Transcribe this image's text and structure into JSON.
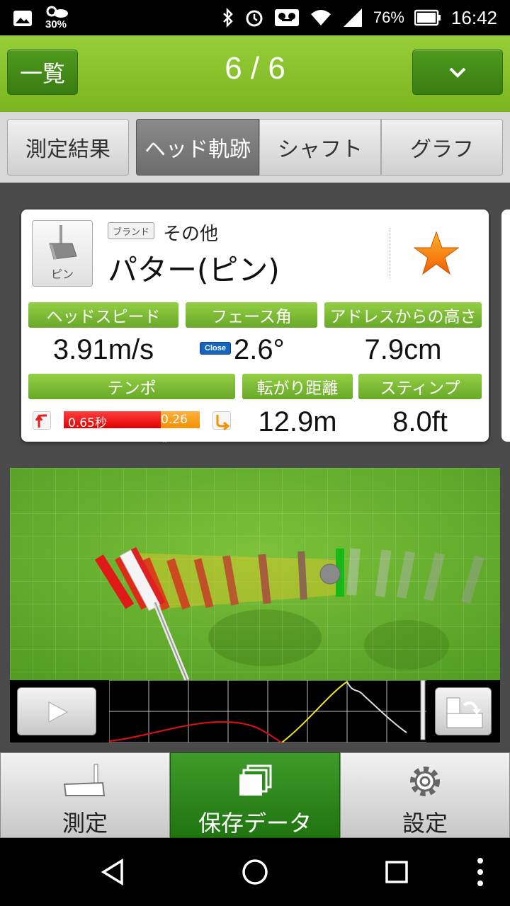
{
  "status_bar": {
    "weather_percent": "30%",
    "battery": "76%",
    "time": "16:42",
    "icons": [
      "image-icon",
      "weather-icon",
      "bluetooth-icon",
      "alarm-icon",
      "voicemail-icon",
      "wifi-icon",
      "signal-icon",
      "battery-icon"
    ]
  },
  "header": {
    "list_button": "一覧",
    "page_counter": "6 / 6",
    "menu_icon": "chevron-down-icon"
  },
  "tabs": [
    {
      "label": "測定結果",
      "active": false
    },
    {
      "label": "ヘッド軌跡",
      "active": true
    },
    {
      "label": "シャフト",
      "active": false
    },
    {
      "label": "グラフ",
      "active": false
    }
  ],
  "card": {
    "club_thumb_label": "ピン",
    "brand_tag": "ブランド",
    "brand_name": "その他",
    "club_name": "パター(ピン)",
    "favorite_icon": "star-icon",
    "favorite_color": "#f07a10",
    "metrics": {
      "head_speed": {
        "label": "ヘッドスピード",
        "value": "3.91m/s"
      },
      "face_angle": {
        "label": "フェース角",
        "badge": "Close",
        "value": "2.6°"
      },
      "address_height": {
        "label": "アドレスからの高さ",
        "value": "7.9cm"
      },
      "tempo": {
        "label": "テンポ",
        "back": "0.65秒",
        "down": "0.26秒"
      },
      "roll_distance": {
        "label": "転がり距離",
        "value": "12.9m"
      },
      "stimp": {
        "label": "スティンプ",
        "value": "8.0ft"
      }
    }
  },
  "graph_strip": {
    "play_icon": "play-icon",
    "rotate_icon": "rotate-view-icon"
  },
  "bottom_nav": [
    {
      "label": "測定",
      "icon": "putter-icon",
      "active": false
    },
    {
      "label": "保存データ",
      "icon": "stack-icon",
      "active": true
    },
    {
      "label": "設定",
      "icon": "gear-icon",
      "active": false
    }
  ],
  "system_nav": [
    "back-icon",
    "home-icon",
    "recents-icon",
    "more-icon"
  ],
  "colors": {
    "header_green": "#8ac22d",
    "pill_green": "#7cbc36",
    "tempo_back": "#f01010",
    "tempo_down": "#f59a20",
    "active_nav": "#2f8a1e"
  }
}
